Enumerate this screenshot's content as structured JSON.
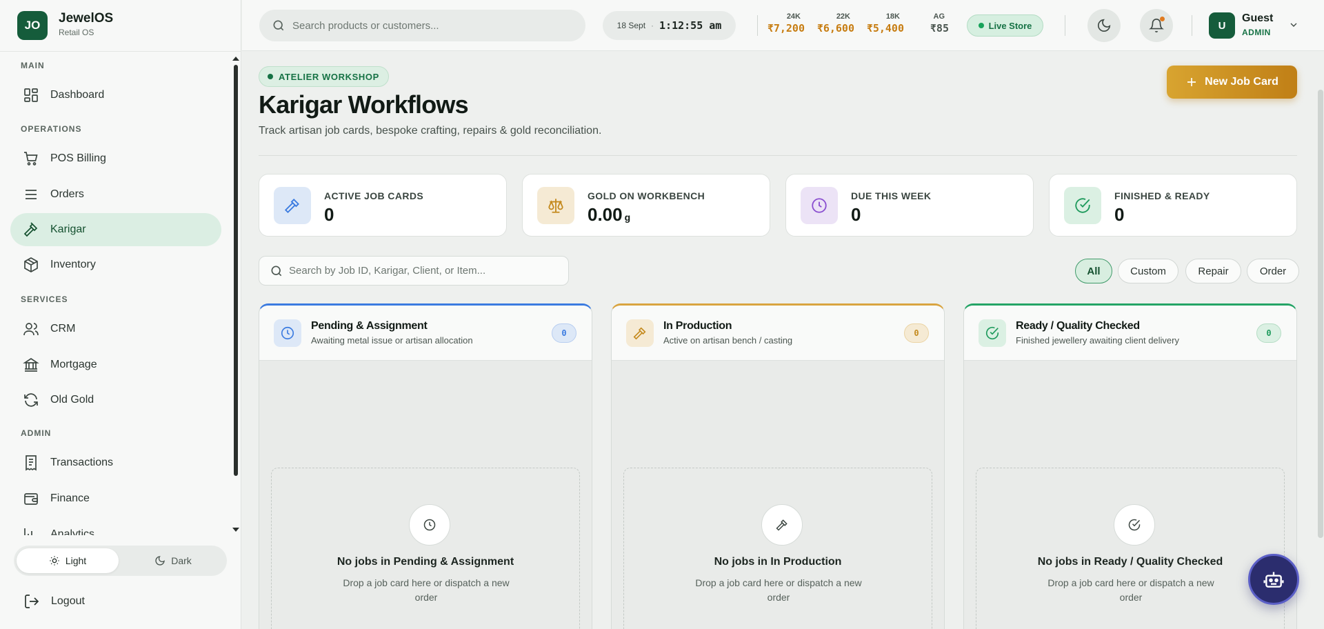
{
  "brand": {
    "logo": "JO",
    "name": "JewelOS",
    "subtitle": "Retail OS"
  },
  "sidebar": {
    "sections": [
      {
        "label": "MAIN"
      },
      {
        "label": "OPERATIONS"
      },
      {
        "label": "SERVICES"
      },
      {
        "label": "ADMIN"
      }
    ],
    "items": [
      {
        "label": "Dashboard",
        "icon": "dashboard-icon"
      },
      {
        "label": "POS Billing",
        "icon": "cart-icon"
      },
      {
        "label": "Orders",
        "icon": "list-icon"
      },
      {
        "label": "Karigar",
        "icon": "hammer-icon",
        "active": true
      },
      {
        "label": "Inventory",
        "icon": "box-icon"
      },
      {
        "label": "CRM",
        "icon": "users-icon"
      },
      {
        "label": "Mortgage",
        "icon": "bank-icon"
      },
      {
        "label": "Old Gold",
        "icon": "refresh-icon"
      },
      {
        "label": "Transactions",
        "icon": "receipt-icon"
      },
      {
        "label": "Finance",
        "icon": "wallet-icon"
      },
      {
        "label": "Analytics",
        "icon": "chart-icon"
      }
    ],
    "theme": {
      "light": "Light",
      "dark": "Dark",
      "selected": "Light"
    },
    "logout": "Logout"
  },
  "header": {
    "search_placeholder": "Search products or customers...",
    "date": "18 Sept",
    "time": "1:12:55 am",
    "rates": [
      {
        "karat": "24K",
        "price": "₹7,200"
      },
      {
        "karat": "22K",
        "price": "₹6,600"
      },
      {
        "karat": "18K",
        "price": "₹5,400"
      },
      {
        "karat": "AG",
        "price": "₹85"
      }
    ],
    "live_label": "Live Store",
    "user": {
      "initial": "U",
      "name": "Guest",
      "role": "ADMIN"
    }
  },
  "page": {
    "badge": "ATELIER WORKSHOP",
    "title": "Karigar Workflows",
    "subtitle": "Track artisan job cards, bespoke crafting, repairs & gold reconciliation.",
    "new_button": "New Job Card"
  },
  "stats": [
    {
      "label": "ACTIVE JOB CARDS",
      "value": "0",
      "unit": "",
      "icon": "hammer-icon",
      "bg": "#dde8f7",
      "color": "#3b7be0"
    },
    {
      "label": "GOLD ON WORKBENCH",
      "value": "0.00",
      "unit": "g",
      "icon": "scale-icon",
      "bg": "#f5ead4",
      "color": "#c48a1e"
    },
    {
      "label": "DUE THIS WEEK",
      "value": "0",
      "unit": "",
      "icon": "clock-icon",
      "bg": "#ece3f6",
      "color": "#8a4fd0"
    },
    {
      "label": "FINISHED & READY",
      "value": "0",
      "unit": "",
      "icon": "check-circle-icon",
      "bg": "#dbf0e3",
      "color": "#1e9a5c"
    }
  ],
  "jobs": {
    "search_placeholder": "Search by Job ID, Karigar, Client, or Item...",
    "filters": [
      "All",
      "Custom",
      "Repair",
      "Order"
    ],
    "selected_filter": "All"
  },
  "columns": [
    {
      "title": "Pending & Assignment",
      "subtitle": "Awaiting metal issue or artisan allocation",
      "count": "0",
      "icon": "clock-icon",
      "accent": "#3b7be0",
      "icon_bg": "#dde8f7",
      "count_bg": "#dde8f7",
      "empty_title": "No jobs in Pending & Assignment",
      "empty_sub": "Drop a job card here or dispatch a new order"
    },
    {
      "title": "In Production",
      "subtitle": "Active on artisan bench / casting",
      "count": "0",
      "icon": "hammer-icon",
      "accent": "#d9a440",
      "icon_bg": "#f5ead4",
      "count_bg": "#f5ead4",
      "empty_title": "No jobs in In Production",
      "empty_sub": "Drop a job card here or dispatch a new order"
    },
    {
      "title": "Ready / Quality Checked",
      "subtitle": "Finished jewellery awaiting client delivery",
      "count": "0",
      "icon": "check-circle-icon",
      "accent": "#24a466",
      "icon_bg": "#dbf0e3",
      "count_bg": "#dbf0e3",
      "empty_title": "No jobs in Ready / Quality Checked",
      "empty_sub": "Drop a job card here or dispatch a new order"
    }
  ]
}
